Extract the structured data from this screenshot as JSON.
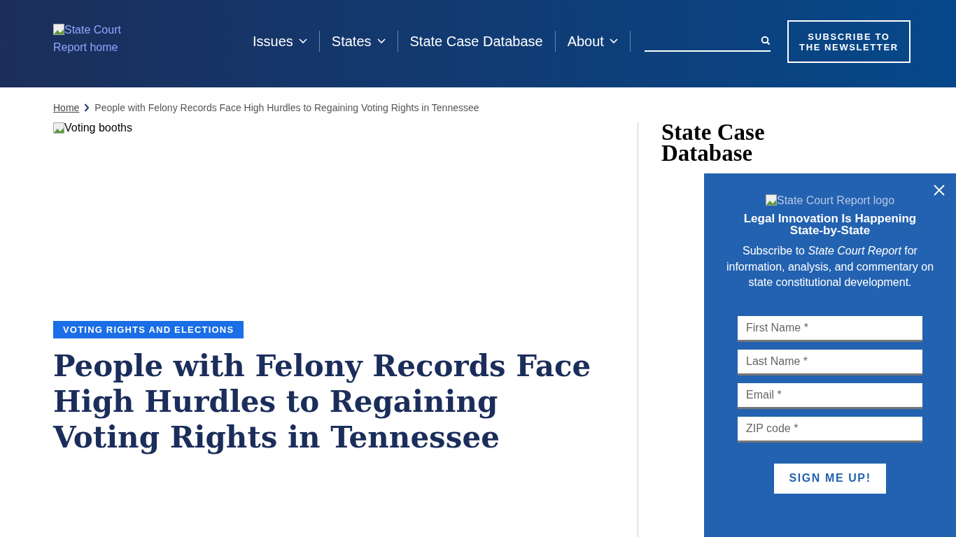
{
  "header": {
    "logo_alt": "State Court Report home",
    "nav": [
      {
        "label": "Issues",
        "dropdown": true
      },
      {
        "label": "States",
        "dropdown": true
      },
      {
        "label": "State Case Database",
        "dropdown": false
      },
      {
        "label": "About",
        "dropdown": true
      }
    ],
    "subscribe_button": "SUBSCRIBE TO THE NEWSLETTER"
  },
  "breadcrumb": {
    "home": "Home",
    "current": "People with Felony Records Face High Hurdles to Regaining Voting Rights in Tennessee"
  },
  "article": {
    "image_alt": "Voting booths",
    "tag": "VOTING RIGHTS AND ELECTIONS",
    "title": "People with Felony Records Face High Hurdles to Regaining Voting Rights in Tennessee"
  },
  "sidebar": {
    "heading": "State Case Database"
  },
  "popup": {
    "logo_alt": "State Court Report logo",
    "heading": "Legal Innovation Is Happening State-by-State",
    "text": "Subscribe to *State Court Report* for information, analysis, and commentary on state constitutional development.",
    "fields": [
      {
        "placeholder": "First Name *"
      },
      {
        "placeholder": "Last Name *"
      },
      {
        "placeholder": "Email *"
      },
      {
        "placeholder": "ZIP code *"
      }
    ],
    "button": "SIGN ME UP!"
  }
}
